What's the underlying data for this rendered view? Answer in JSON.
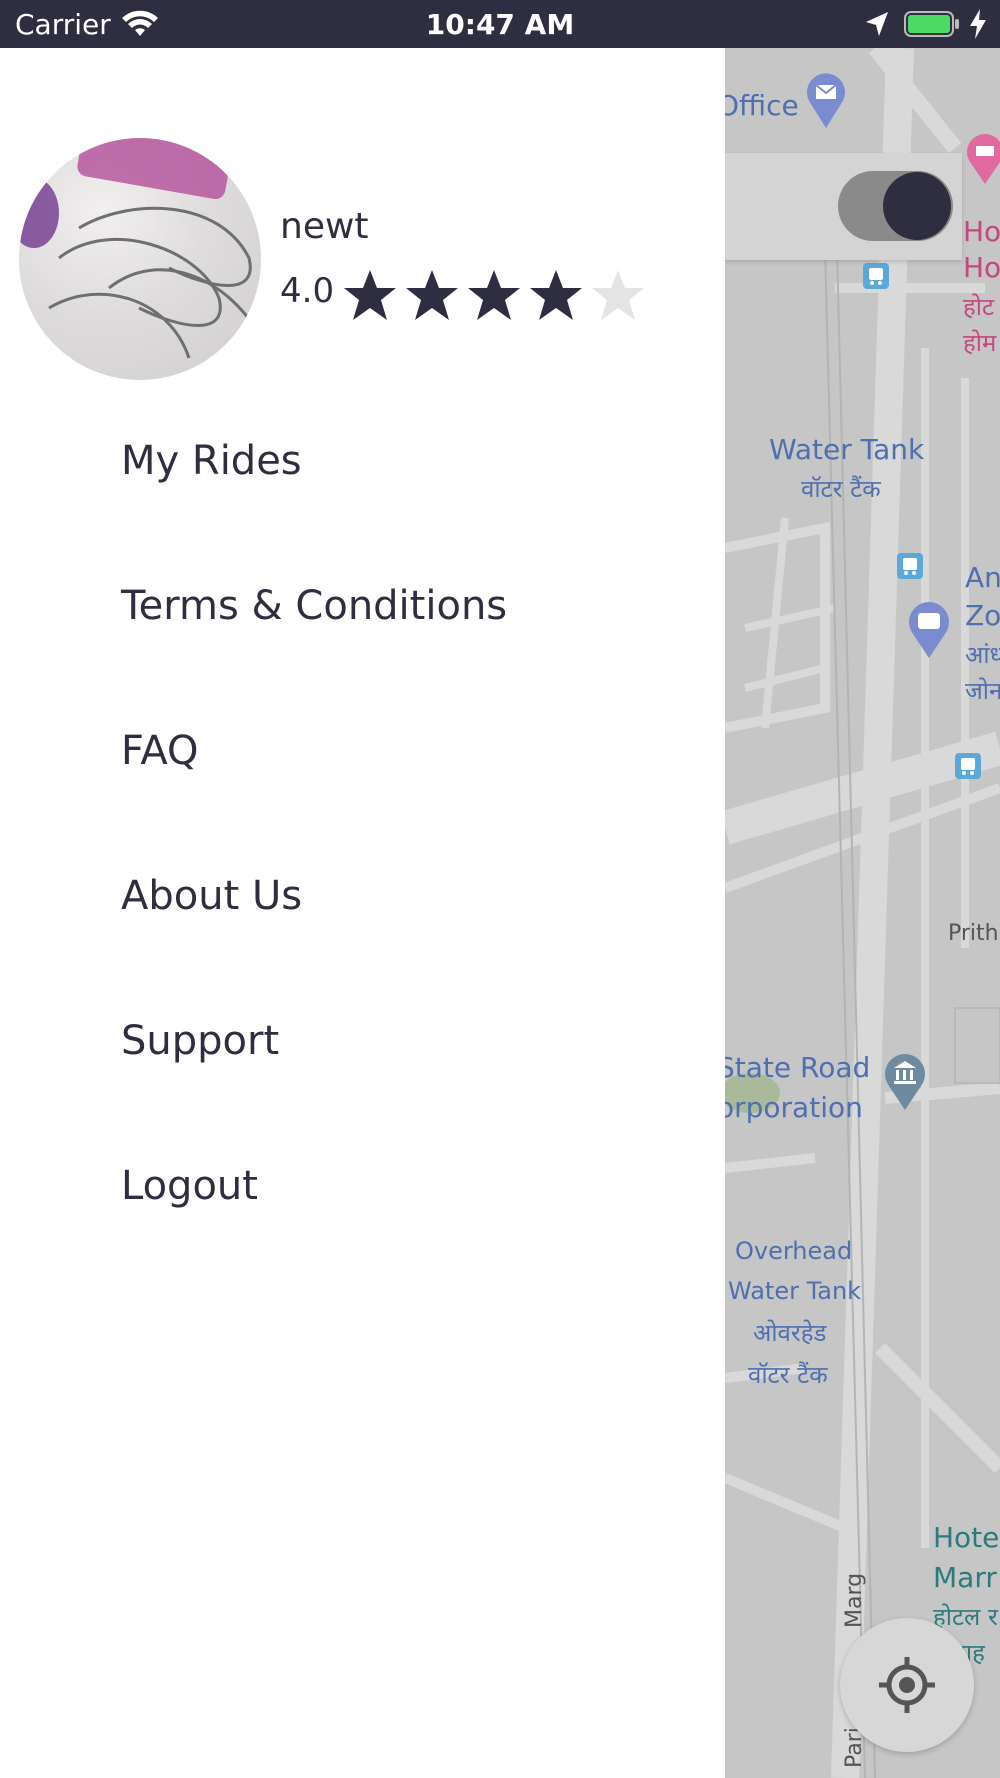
{
  "status_bar": {
    "carrier": "Carrier",
    "time": "10:47 AM"
  },
  "profile": {
    "name": "newt",
    "rating_text": "4.0",
    "rating_value": 4,
    "rating_max": 5
  },
  "menu": {
    "items": [
      {
        "label": "My Rides"
      },
      {
        "label": "Terms & Conditions"
      },
      {
        "label": "FAQ"
      },
      {
        "label": "About Us"
      },
      {
        "label": "Support"
      },
      {
        "label": "Logout"
      }
    ]
  },
  "map": {
    "labels": {
      "office": "Office",
      "water_tank": "Water Tank",
      "water_tank_hi": "वॉटर टैंक",
      "state_road_1": "State Road",
      "state_road_2": "orporation",
      "overhead_1": "Overhead",
      "overhead_2": "Water Tank",
      "overhead_hi_1": "ओवरहेड",
      "overhead_hi_2": "वॉटर टैंक",
      "prith": "Prith",
      "ho_1": "Ho",
      "ho_2": "Ho",
      "ho_hi_1": "होट",
      "ho_hi_2": "होम",
      "an": "An",
      "zo": "Zo",
      "an_hi": "आंध्",
      "zo_hi": "जोन",
      "hotel_1": "Hote",
      "hotel_2": "Marr",
      "hotel_hi_1": "होटल र",
      "hotel_hi_2": "विवाह",
      "road_marg": "Marg",
      "road_pari": "Pari"
    },
    "driver_toggle_on": true
  },
  "colors": {
    "primary_dark": "#2e2e40",
    "star_empty": "#e4e4e4",
    "map_bg": "#c6c6c6"
  }
}
